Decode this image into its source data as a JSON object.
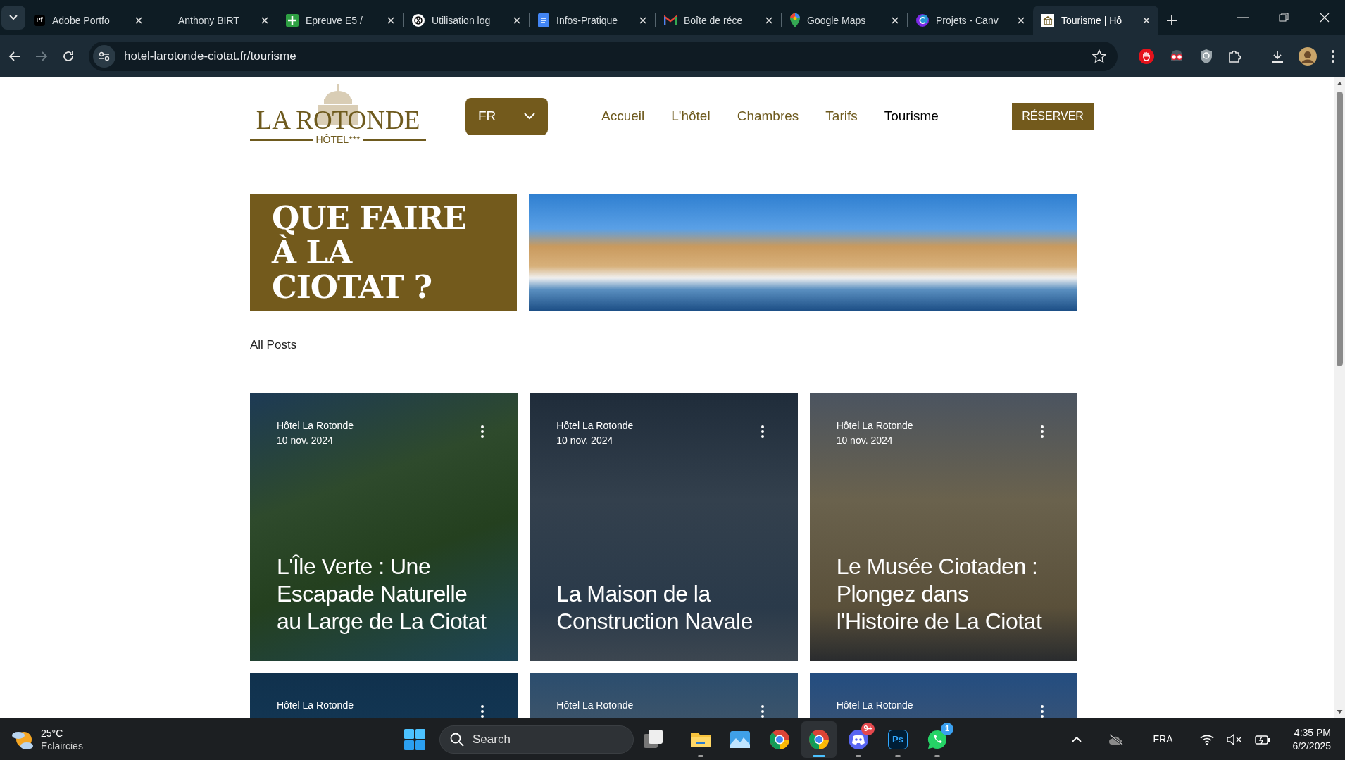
{
  "browser": {
    "tabs": [
      {
        "title": "Adobe Portfo",
        "selected": false
      },
      {
        "title": "Anthony BIRT",
        "selected": false
      },
      {
        "title": "Epreuve E5 /",
        "selected": false
      },
      {
        "title": "Utilisation log",
        "selected": false
      },
      {
        "title": "Infos-Pratique",
        "selected": false
      },
      {
        "title": "Boîte de réce",
        "selected": false
      },
      {
        "title": "Google Maps",
        "selected": false
      },
      {
        "title": "Projets - Canv",
        "selected": false
      },
      {
        "title": "Tourisme | Hô",
        "selected": true
      }
    ],
    "tab_icon_text": "Pf",
    "address": "hotel-larotonde-ciotat.fr/tourisme"
  },
  "header": {
    "logo": {
      "name": "LA ROTONDE",
      "sub": "HÔTEL",
      "stars": "***"
    },
    "language": "FR",
    "nav": [
      {
        "label": "Accueil",
        "selected": false
      },
      {
        "label": "L'hôtel",
        "selected": false
      },
      {
        "label": "Chambres",
        "selected": false
      },
      {
        "label": "Tarifs",
        "selected": false
      },
      {
        "label": "Tourisme",
        "selected": true
      }
    ],
    "book_button": "RÉSERVER"
  },
  "hero": {
    "title_lines": [
      "QUE FAIRE",
      "À LA",
      "CIOTAT ?"
    ]
  },
  "category_link": "All Posts",
  "posts": [
    {
      "author": "Hôtel La Rotonde",
      "date": "10 nov. 2024",
      "title": "L'Île Verte : Une Escapade Naturelle au Large de La Ciotat"
    },
    {
      "author": "Hôtel La Rotonde",
      "date": "10 nov. 2024",
      "title": "La Maison de la Construction Navale"
    },
    {
      "author": "Hôtel La Rotonde",
      "date": "10 nov. 2024",
      "title": "Le Musée Ciotaden : Plongez dans l'Histoire de La Ciotat"
    },
    {
      "author": "Hôtel La Rotonde"
    },
    {
      "author": "Hôtel La Rotonde"
    },
    {
      "author": "Hôtel La Rotonde"
    }
  ],
  "taskbar": {
    "weather": {
      "temp": "25°C",
      "condition": "Eclaircies"
    },
    "search_placeholder": "Search",
    "apps": [
      {
        "kind": "files",
        "running": true,
        "selected": false
      },
      {
        "kind": "photos",
        "running": false,
        "selected": false
      },
      {
        "kind": "chrome",
        "running": false,
        "selected": false
      },
      {
        "kind": "chrome",
        "running": true,
        "selected": true
      },
      {
        "kind": "discord",
        "running": true,
        "selected": false,
        "badge": "9+"
      },
      {
        "kind": "photoshop",
        "running": true,
        "selected": false,
        "label": "Ps"
      },
      {
        "kind": "whatsapp",
        "running": true,
        "selected": false,
        "badge": "1"
      }
    ],
    "language": "FRA",
    "time": "4:35 PM",
    "date": "6/2/2025"
  }
}
